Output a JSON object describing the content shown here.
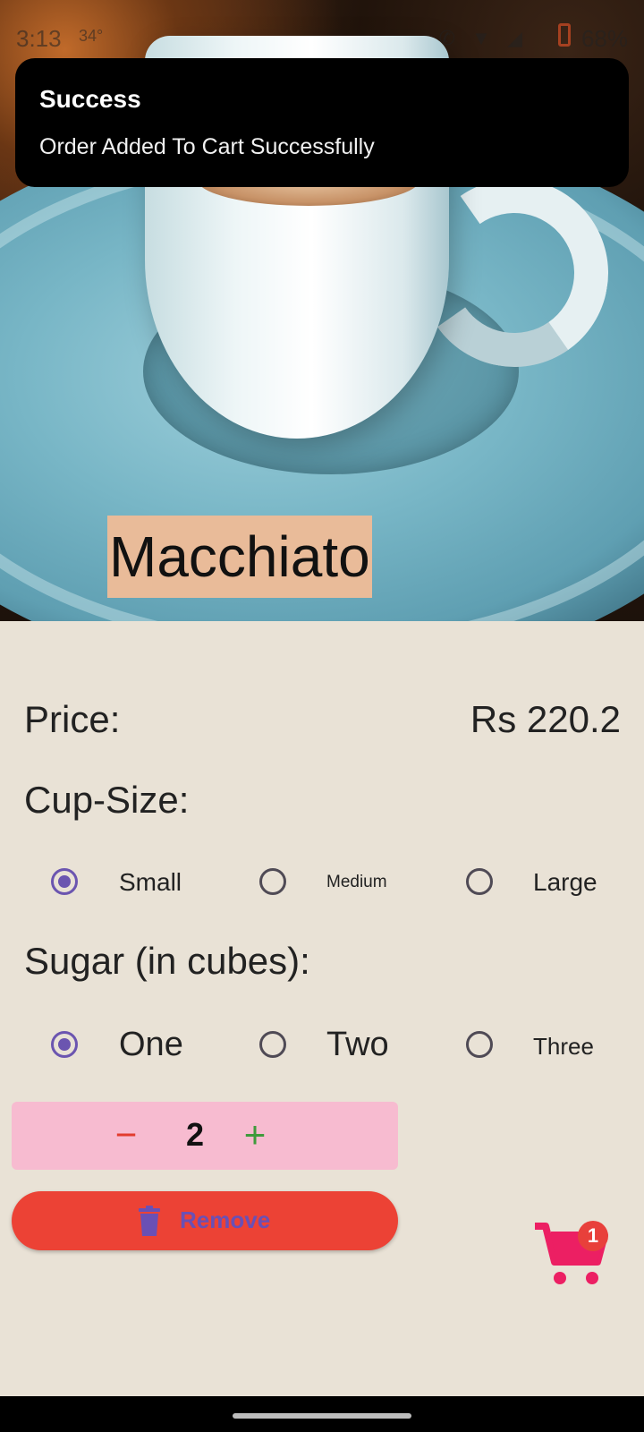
{
  "status_bar": {
    "time": "3:13",
    "temperature": "34°",
    "battery": "68%"
  },
  "snackbar": {
    "title": "Success",
    "message": "Order Added To Cart Successfully"
  },
  "product": {
    "name": "Macchiato",
    "price_label": "Price:",
    "price_value": "Rs 220.2"
  },
  "cup_size": {
    "label": "Cup-Size:",
    "options": [
      "Small",
      "Medium",
      "Large"
    ],
    "selected": "Small"
  },
  "sugar": {
    "label": "Sugar (in cubes):",
    "options": [
      "One",
      "Two",
      "Three"
    ],
    "selected": "One"
  },
  "quantity": {
    "minus": "−",
    "value": "2",
    "plus": "+"
  },
  "remove_button": {
    "label": "Remove",
    "icon": "trash-icon"
  },
  "cart": {
    "icon": "shopping-cart-icon",
    "badge_count": "1"
  },
  "colors": {
    "background": "#e9e2d6",
    "title_highlight": "#e9bb99",
    "radio_selected": "#6b55b0",
    "quantity_bg": "#f7bbd0",
    "remove_bg": "#ec4235",
    "cart_color": "#ec1f63"
  }
}
